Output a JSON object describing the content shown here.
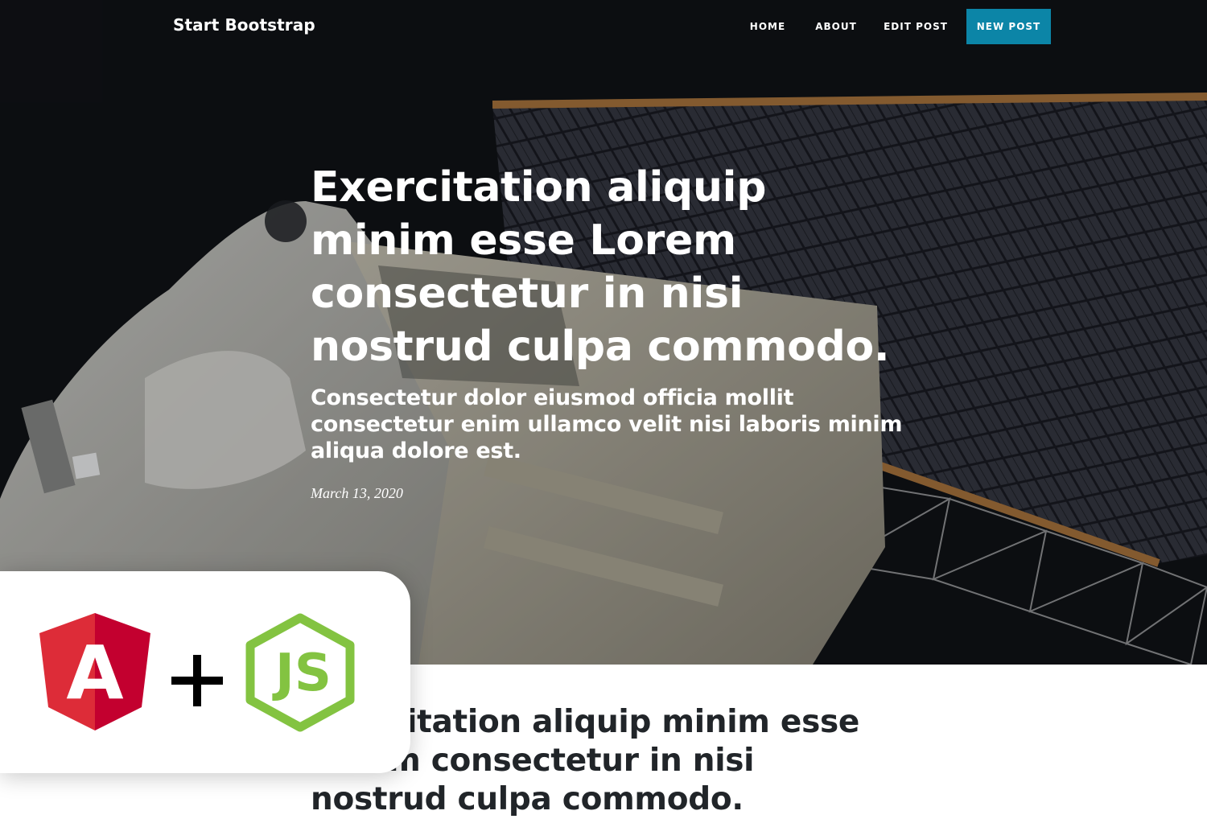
{
  "navbar": {
    "brand": "Start Bootstrap",
    "links": [
      {
        "label": "HOME"
      },
      {
        "label": "ABOUT"
      },
      {
        "label": "EDIT POST"
      },
      {
        "label": "NEW POST"
      }
    ]
  },
  "hero": {
    "title": "Exercitation aliquip minim esse Lorem consectetur in nisi nostrud culpa commodo.",
    "subtitle": "Consectetur dolor eiusmod officia mollit consectetur enim ullamco velit nisi laboris minim aliqua dolore est.",
    "date": "March 13, 2020"
  },
  "article": {
    "title": "Exercitation aliquip minim esse Lorem consectetur in nisi nostrud culpa commodo."
  },
  "logo_card": {
    "angular_letter": "A",
    "plus": "+",
    "node_text": "JS"
  },
  "colors": {
    "accent": "#0c85a7",
    "angular_red": "#dd2c38",
    "node_green": "#83c341",
    "dark_bg": "#0c0d10"
  },
  "icons": [
    "angular-logo-icon",
    "plus-icon",
    "nodejs-logo-icon"
  ]
}
